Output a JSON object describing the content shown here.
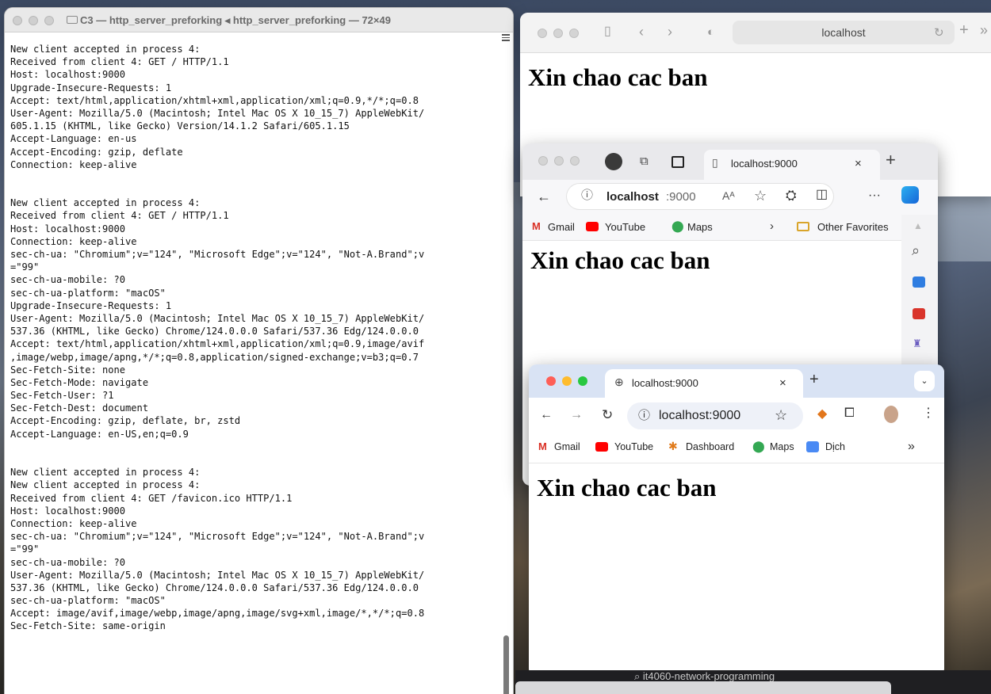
{
  "terminal": {
    "title": "C3 — http_server_preforking ◂ http_server_preforking — 72×49",
    "lines": [
      "New client accepted in process 4:",
      "Received from client 4: GET / HTTP/1.1",
      "Host: localhost:9000",
      "Upgrade-Insecure-Requests: 1",
      "Accept: text/html,application/xhtml+xml,application/xml;q=0.9,*/*;q=0.8",
      "User-Agent: Mozilla/5.0 (Macintosh; Intel Mac OS X 10_15_7) AppleWebKit/",
      "605.1.15 (KHTML, like Gecko) Version/14.1.2 Safari/605.1.15",
      "Accept-Language: en-us",
      "Accept-Encoding: gzip, deflate",
      "Connection: keep-alive",
      "",
      "",
      "New client accepted in process 4:",
      "Received from client 4: GET / HTTP/1.1",
      "Host: localhost:9000",
      "Connection: keep-alive",
      "sec-ch-ua: \"Chromium\";v=\"124\", \"Microsoft Edge\";v=\"124\", \"Not-A.Brand\";v",
      "=\"99\"",
      "sec-ch-ua-mobile: ?0",
      "sec-ch-ua-platform: \"macOS\"",
      "Upgrade-Insecure-Requests: 1",
      "User-Agent: Mozilla/5.0 (Macintosh; Intel Mac OS X 10_15_7) AppleWebKit/",
      "537.36 (KHTML, like Gecko) Chrome/124.0.0.0 Safari/537.36 Edg/124.0.0.0",
      "Accept: text/html,application/xhtml+xml,application/xml;q=0.9,image/avif",
      ",image/webp,image/apng,*/*;q=0.8,application/signed-exchange;v=b3;q=0.7",
      "Sec-Fetch-Site: none",
      "Sec-Fetch-Mode: navigate",
      "Sec-Fetch-User: ?1",
      "Sec-Fetch-Dest: document",
      "Accept-Encoding: gzip, deflate, br, zstd",
      "Accept-Language: en-US,en;q=0.9",
      "",
      "",
      "New client accepted in process 4:",
      "New client accepted in process 4:",
      "Received from client 4: GET /favicon.ico HTTP/1.1",
      "Host: localhost:9000",
      "Connection: keep-alive",
      "sec-ch-ua: \"Chromium\";v=\"124\", \"Microsoft Edge\";v=\"124\", \"Not-A.Brand\";v",
      "=\"99\"",
      "sec-ch-ua-mobile: ?0",
      "User-Agent: Mozilla/5.0 (Macintosh; Intel Mac OS X 10_15_7) AppleWebKit/",
      "537.36 (KHTML, like Gecko) Chrome/124.0.0.0 Safari/537.36 Edg/124.0.0.0",
      "sec-ch-ua-platform: \"macOS\"",
      "Accept: image/avif,image/webp,image/apng,image/svg+xml,image/*,*/*;q=0.8",
      "Sec-Fetch-Site: same-origin"
    ]
  },
  "safari": {
    "url": "localhost",
    "heading": "Xin chao cac ban"
  },
  "edge": {
    "tab_title": "localhost:9000",
    "url_host": "localhost",
    "url_port": ":9000",
    "favorites": [
      "Gmail",
      "YouTube",
      "Maps"
    ],
    "other_favorites": "Other Favorites",
    "heading": "Xin chao cac ban"
  },
  "chrome": {
    "tab_title": "localhost:9000",
    "url": "localhost:9000",
    "bookmarks": [
      "Gmail",
      "YouTube",
      "Dashboard",
      "Maps",
      "Dịch"
    ],
    "heading": "Xin chao cac ban"
  },
  "taskbar": {
    "search_text": "⌕ it4060-network-programming"
  },
  "colors": {
    "red": "#fe5f57",
    "yellow": "#febc2e",
    "green": "#28c840",
    "chrome_top": "#d9e3f4"
  }
}
